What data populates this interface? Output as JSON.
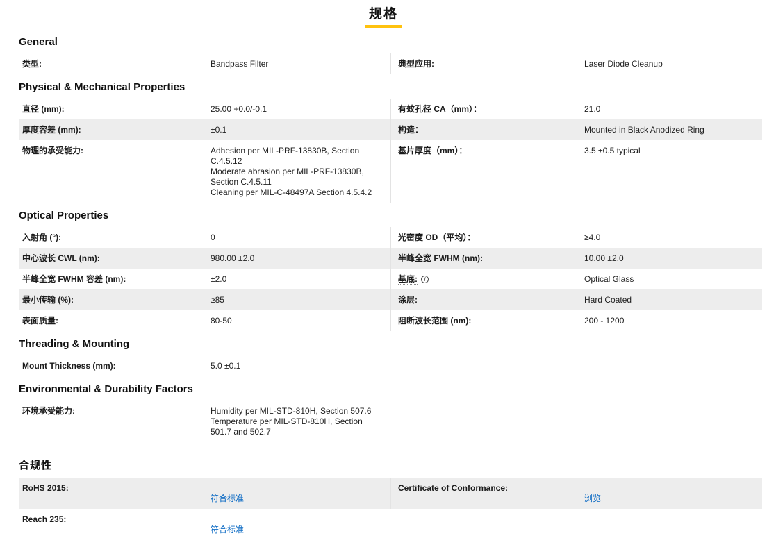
{
  "title": "规格",
  "colors": {
    "accent": "#FFC20E",
    "link": "#0d6bc4",
    "row_alt": "#ededed"
  },
  "sections": {
    "general": {
      "heading": "General",
      "rows": [
        {
          "l_label": "类型:",
          "l_value": "Bandpass Filter",
          "r_label": "典型应用:",
          "r_value": "Laser Diode Cleanup"
        }
      ]
    },
    "physical": {
      "heading": "Physical & Mechanical Properties",
      "rows": [
        {
          "l_label": "直径 (mm):",
          "l_value": "25.00 +0.0/-0.1",
          "r_label": "有效孔径 CA（mm）：",
          "r_value": "21.0"
        },
        {
          "l_label": "厚度容差 (mm):",
          "l_value": "±0.1",
          "r_label": "构造：",
          "r_value": "Mounted in Black Anodized Ring"
        },
        {
          "l_label": "物理的承受能力:",
          "l_value": "Adhesion per MIL-PRF-13830B, Section C.4.5.12\nModerate abrasion per MIL-PRF-13830B, Section C.4.5.11\nCleaning per MIL-C-48497A Section 4.5.4.2",
          "r_label": "基片厚度（mm）：",
          "r_value": "3.5 ±0.5 typical"
        }
      ]
    },
    "optical": {
      "heading": "Optical Properties",
      "rows": [
        {
          "l_label": "入射角 (°):",
          "l_value": "0",
          "r_label": "光密度 OD（平均）：",
          "r_value": "≥4.0"
        },
        {
          "l_label": "中心波长 CWL (nm):",
          "l_value": "980.00 ±2.0",
          "r_label": "半峰全宽 FWHM (nm):",
          "r_value": "10.00 ±2.0"
        },
        {
          "l_label": "半峰全宽 FWHM 容差 (nm):",
          "l_value": "±2.0",
          "r_label": "基底:",
          "r_info_icon": "info-icon",
          "r_value": "Optical Glass"
        },
        {
          "l_label": "最小传输 (%):",
          "l_value": "≥85",
          "r_label": "涂层:",
          "r_value": "Hard Coated"
        },
        {
          "l_label": "表面质量:",
          "l_value": "80-50",
          "r_label": "阻断波长范围 (nm):",
          "r_value": "200 - 1200"
        }
      ]
    },
    "threading": {
      "heading": "Threading & Mounting",
      "rows": [
        {
          "l_label": "Mount Thickness (mm):",
          "l_value": "5.0 ±0.1"
        }
      ]
    },
    "environmental": {
      "heading": "Environmental & Durability Factors",
      "rows": [
        {
          "l_label": "环境承受能力:",
          "l_value": "Humidity per MIL-STD-810H, Section 507.6\nTemperature per MIL-STD-810H, Section 501.7 and 502.7"
        }
      ]
    },
    "compliance": {
      "heading": "合规性",
      "rows": [
        {
          "l_label": "RoHS 2015:",
          "l_link": "符合标准",
          "r_label": "Certificate of Conformance:",
          "r_link": "浏览"
        },
        {
          "l_label": "Reach 235:",
          "l_link": "符合标准"
        }
      ]
    }
  }
}
